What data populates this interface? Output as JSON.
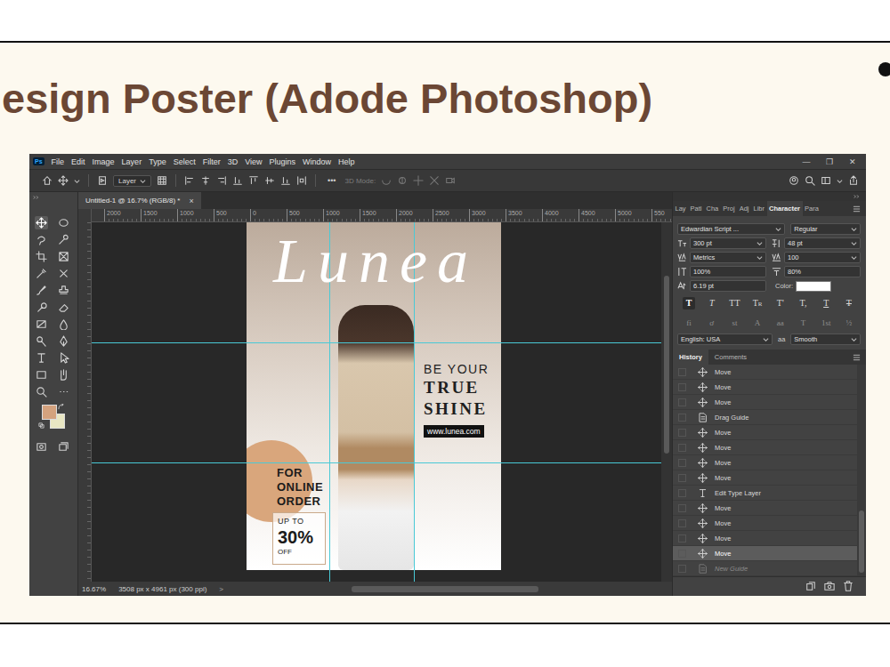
{
  "slide": {
    "title": "esign Poster (Adode Photoshop)"
  },
  "window": {
    "logo": "Ps",
    "menu": [
      "File",
      "Edit",
      "Image",
      "Layer",
      "Type",
      "Select",
      "Filter",
      "3D",
      "View",
      "Plugins",
      "Window",
      "Help"
    ],
    "controls": [
      "—",
      "❐",
      "✕"
    ]
  },
  "options_bar": {
    "layer_dropdown": "Layer",
    "more": "•••",
    "mode_label": "3D Mode:"
  },
  "document_tab": {
    "title": "Untitled-1 @ 16.7% (RGB/8) *",
    "close": "×"
  },
  "ruler": {
    "ticks": [
      "2000",
      "1500",
      "1000",
      "500",
      "0",
      "500",
      "1000",
      "1500",
      "2000",
      "2500",
      "3000",
      "3500",
      "4000",
      "4500",
      "5000",
      "550"
    ]
  },
  "tools": [
    {
      "selected": true
    },
    {
      "selected": false
    },
    {
      "selected": false
    },
    {
      "selected": false
    },
    {
      "selected": false
    },
    {
      "selected": false
    },
    {
      "selected": false
    },
    {
      "selected": false
    },
    {
      "selected": false
    },
    {
      "selected": false
    },
    {
      "selected": false
    },
    {
      "selected": false
    },
    {
      "selected": false
    },
    {
      "selected": false
    },
    {
      "selected": false
    },
    {
      "selected": false
    },
    {
      "selected": false
    },
    {
      "selected": false
    },
    {
      "selected": false
    },
    {
      "selected": false
    },
    {
      "selected": false
    },
    {
      "selected": false
    },
    {
      "selected": false
    },
    {
      "selected": false
    }
  ],
  "poster": {
    "brand": "Lunea",
    "tagline_small": "BE YOUR",
    "tagline": [
      "TRUE",
      "SHINE"
    ],
    "website": "www.lunea.com",
    "offer_lines": [
      "FOR",
      "ONLINE",
      "ORDER"
    ],
    "discount": {
      "prefix": "UP TO",
      "value": "30%",
      "suffix": "OFF"
    }
  },
  "panel_tabs": [
    {
      "label": "Lay",
      "selected": false
    },
    {
      "label": "Patl",
      "selected": false
    },
    {
      "label": "Cha",
      "selected": false
    },
    {
      "label": "Proj",
      "selected": false
    },
    {
      "label": "Adj",
      "selected": false
    },
    {
      "label": "Libr",
      "selected": false
    },
    {
      "label": "Character",
      "selected": true
    },
    {
      "label": "Para",
      "selected": false
    }
  ],
  "character": {
    "font_family": "Edwardian Script ...",
    "font_style": "Regular",
    "size": "300 pt",
    "leading": "48 pt",
    "kerning": "Metrics",
    "tracking": "100",
    "vertical_scale": "100%",
    "horizontal_scale": "80%",
    "baseline_shift": "6.19 pt",
    "color_label": "Color:",
    "style_buttons": [
      {
        "label": "T",
        "kind": "bold",
        "selected": true
      },
      {
        "label": "T",
        "kind": "italic",
        "selected": false
      },
      {
        "label": "TT",
        "kind": "allcaps",
        "selected": false
      },
      {
        "label": "Tr",
        "kind": "smallcaps",
        "selected": false
      },
      {
        "label": "T'",
        "kind": "superscript",
        "selected": false
      },
      {
        "label": "T,",
        "kind": "subscript",
        "selected": false
      },
      {
        "label": "T",
        "kind": "underline",
        "selected": false
      },
      {
        "label": "T",
        "kind": "strikethrough",
        "selected": false
      }
    ],
    "opentype_buttons": [
      "fi",
      "ơ",
      "st",
      "A",
      "aa",
      "T",
      "1st",
      "½"
    ],
    "language": "English: USA",
    "aa_label": "aa",
    "antialias": "Smooth"
  },
  "history": {
    "tabs": [
      {
        "label": "History",
        "selected": true
      },
      {
        "label": "Comments",
        "selected": false
      }
    ],
    "items": [
      {
        "label": "Move",
        "kind": "move",
        "selected": false,
        "disabled": false
      },
      {
        "label": "Move",
        "kind": "move",
        "selected": false,
        "disabled": false
      },
      {
        "label": "Move",
        "kind": "move",
        "selected": false,
        "disabled": false
      },
      {
        "label": "Drag Guide",
        "kind": "guide",
        "selected": false,
        "disabled": false
      },
      {
        "label": "Move",
        "kind": "move",
        "selected": false,
        "disabled": false
      },
      {
        "label": "Move",
        "kind": "move",
        "selected": false,
        "disabled": false
      },
      {
        "label": "Move",
        "kind": "move",
        "selected": false,
        "disabled": false
      },
      {
        "label": "Move",
        "kind": "move",
        "selected": false,
        "disabled": false
      },
      {
        "label": "Edit Type Layer",
        "kind": "type",
        "selected": false,
        "disabled": false
      },
      {
        "label": "Move",
        "kind": "move",
        "selected": false,
        "disabled": false
      },
      {
        "label": "Move",
        "kind": "move",
        "selected": false,
        "disabled": false
      },
      {
        "label": "Move",
        "kind": "move",
        "selected": false,
        "disabled": false
      },
      {
        "label": "Move",
        "kind": "move",
        "selected": true,
        "disabled": false
      },
      {
        "label": "New Guide",
        "kind": "guide",
        "selected": false,
        "disabled": true
      }
    ]
  },
  "status_bar": {
    "zoom": "16.67%",
    "doc_size": "3508 px x 4961 px (300 ppi)",
    "arrow": ">"
  }
}
